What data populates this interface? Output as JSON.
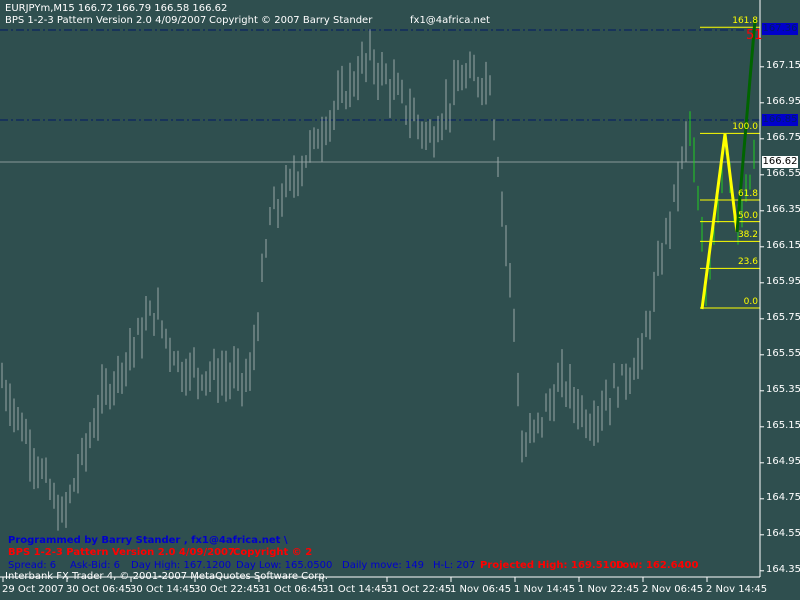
{
  "header": {
    "symbol_line": "EURJPYm,M15  166.72 166.79 166.58 166.62",
    "indicator_name": "BPS 1-2-3 Pattern  Version 2.0  4/09/2007",
    "copyright": "Copyright © 2007 Barry Stander",
    "email": "fx1@4africa.net"
  },
  "info": {
    "programmed": "Programmed by Barry Stander ,  fx1@4africa.net  \\",
    "version": "BPS 1-2-3 Pattern  Version 2.0  4/09/2007",
    "copyright2": "Copyright © 2",
    "spread": "Spread:  6",
    "ask_bid": "Ask-Bid:  6",
    "day_high": "Day High:  167.1200",
    "day_low": "Day Low:  165.0500",
    "daily_move": "Daily move:  149",
    "hl": "H-L:  207",
    "projected_high": "Projected High:  169.5100",
    "projected_low": "Low:   162.6400",
    "footer": "Interbank FX Trader 4, © 2001-2007 MetaQuotes Software Corp."
  },
  "price_axis": [
    "167.15",
    "166.95",
    "166.75",
    "166.55",
    "166.35",
    "166.15",
    "165.95",
    "165.75",
    "165.55",
    "165.35",
    "165.15",
    "164.95",
    "164.75",
    "164.55",
    "164.35"
  ],
  "price_markers": {
    "upper": "167.36",
    "mid": "166.85",
    "current": "166.62"
  },
  "time_axis": [
    "29 Oct 2007",
    "30 Oct 06:45",
    "30 Oct 14:45",
    "30 Oct 22:45",
    "31 Oct 06:45",
    "31 Oct 14:45",
    "31 Oct 22:45",
    "1 Nov 06:45",
    "1 Nov 14:45",
    "1 Nov 22:45",
    "2 Nov 06:45",
    "2 Nov 14:45"
  ],
  "fib_levels": [
    {
      "label": "161.8",
      "price": 167.37
    },
    {
      "label": "100.0",
      "price": 166.78
    },
    {
      "label": "61.8",
      "price": 166.41
    },
    {
      "label": "50.0",
      "price": 166.29
    },
    {
      "label": "38.2",
      "price": 166.18
    },
    {
      "label": "23.6",
      "price": 166.03
    },
    {
      "label": "0.0",
      "price": 165.81
    }
  ],
  "projection_label": "51",
  "colors": {
    "bg": "#2f4f4f",
    "bars": "#9aa7a7",
    "recent_bars": "#22cc22",
    "fib": "#ffff00",
    "projection": "#006400",
    "marker": "#0000cc"
  },
  "chart_data": {
    "type": "bar",
    "symbol": "EURJPYm",
    "timeframe": "M15",
    "ylim": [
      164.3,
      167.5
    ],
    "path": [
      [
        0,
        165.41
      ],
      [
        15,
        164.63
      ],
      [
        25,
        165.3
      ],
      [
        38,
        165.8
      ],
      [
        45,
        165.47
      ],
      [
        62,
        165.41
      ],
      [
        67,
        166.3
      ],
      [
        80,
        166.8
      ],
      [
        88,
        167.08
      ],
      [
        92,
        167.2
      ],
      [
        107,
        166.75
      ],
      [
        115,
        167.08
      ],
      [
        122,
        167.08
      ],
      [
        125,
        166.4
      ],
      [
        128,
        165.75
      ],
      [
        130,
        165.0
      ],
      [
        140,
        165.4
      ],
      [
        147,
        165.18
      ],
      [
        160,
        165.55
      ],
      [
        165,
        166.1
      ],
      [
        172,
        166.83
      ],
      [
        176,
        165.9
      ],
      [
        181,
        166.75
      ],
      [
        184,
        166.2
      ],
      [
        188,
        166.62
      ]
    ]
  }
}
